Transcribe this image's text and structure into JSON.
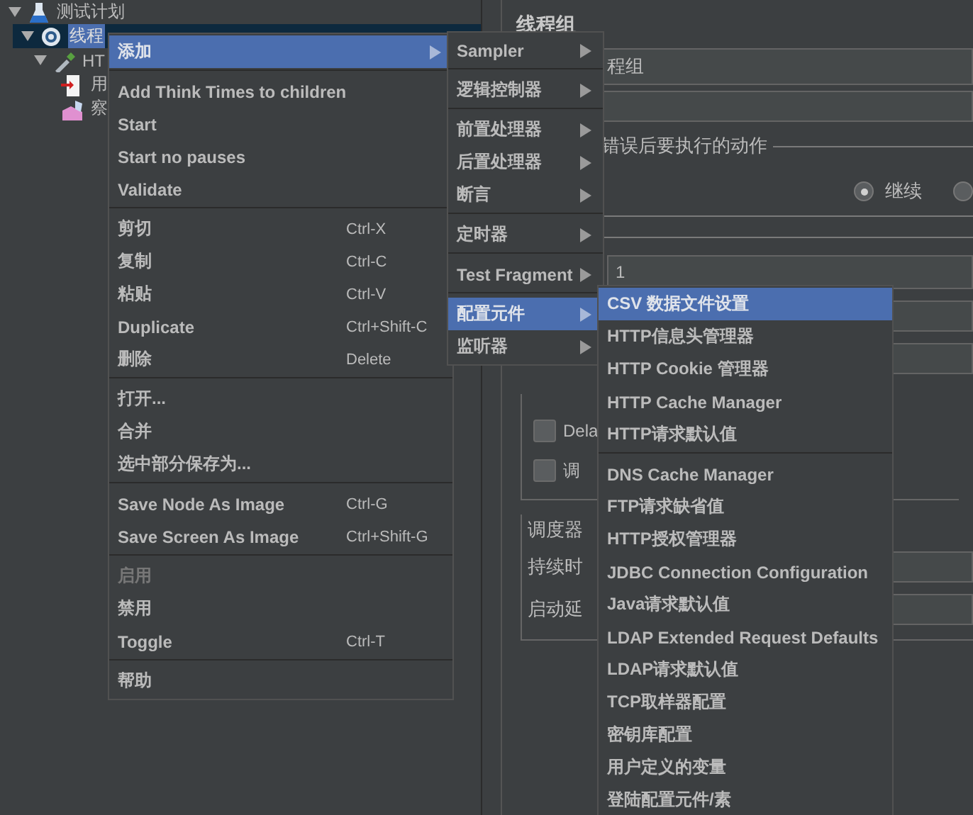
{
  "tree": [
    {
      "kind": "test-plan",
      "label": "测试计划",
      "expanded": true,
      "selected": false,
      "children": [
        {
          "kind": "thread-group",
          "label": "线程",
          "expanded": true,
          "selected": true,
          "children": [
            {
              "kind": "sampler",
              "label": "HT",
              "expanded": true,
              "selected": false,
              "children": [
                {
                  "kind": "config",
                  "label": "用",
                  "selected": false
                },
                {
                  "kind": "listener",
                  "label": "察",
                  "selected": false
                }
              ]
            }
          ]
        }
      ]
    }
  ],
  "form": {
    "title": "线程组",
    "name_value": "程组",
    "on_error_title": "错误后要执行的动作",
    "radios": [
      {
        "label": "继续",
        "selected": true
      },
      {
        "selected": false
      }
    ],
    "thread_count_value": "1",
    "checkboxes": [
      {
        "label": "Dela",
        "checked": false
      },
      {
        "label": "调",
        "checked": false
      }
    ],
    "scheduler_title": "调度器",
    "scheduler_rows": [
      "持续时",
      "启动延"
    ]
  },
  "menus": [
    {
      "items": [
        {
          "kind": "item",
          "label": "添加",
          "submenu": true,
          "selected": true,
          "disabled": false
        },
        {
          "kind": "separator"
        },
        {
          "kind": "item",
          "label": "Add Think Times to children",
          "submenu": false,
          "selected": false,
          "disabled": false
        },
        {
          "kind": "item",
          "label": "Start",
          "submenu": false,
          "selected": false,
          "disabled": false
        },
        {
          "kind": "item",
          "label": "Start no pauses",
          "submenu": false,
          "selected": false,
          "disabled": false
        },
        {
          "kind": "item",
          "label": "Validate",
          "submenu": false,
          "selected": false,
          "disabled": false
        },
        {
          "kind": "separator"
        },
        {
          "kind": "item",
          "label": "剪切",
          "shortcut": "Ctrl-X",
          "submenu": false,
          "selected": false,
          "disabled": false
        },
        {
          "kind": "item",
          "label": "复制",
          "shortcut": "Ctrl-C",
          "submenu": false,
          "selected": false,
          "disabled": false
        },
        {
          "kind": "item",
          "label": "粘贴",
          "shortcut": "Ctrl-V",
          "submenu": false,
          "selected": false,
          "disabled": false
        },
        {
          "kind": "item",
          "label": "Duplicate",
          "shortcut": "Ctrl+Shift-C",
          "submenu": false,
          "selected": false,
          "disabled": false
        },
        {
          "kind": "item",
          "label": "删除",
          "shortcut": "Delete",
          "submenu": false,
          "selected": false,
          "disabled": false
        },
        {
          "kind": "separator"
        },
        {
          "kind": "item",
          "label": "打开...",
          "submenu": false,
          "selected": false,
          "disabled": false
        },
        {
          "kind": "item",
          "label": "合并",
          "submenu": false,
          "selected": false,
          "disabled": false
        },
        {
          "kind": "item",
          "label": "选中部分保存为...",
          "submenu": false,
          "selected": false,
          "disabled": false
        },
        {
          "kind": "separator"
        },
        {
          "kind": "item",
          "label": "Save Node As Image",
          "shortcut": "Ctrl-G",
          "submenu": false,
          "selected": false,
          "disabled": false
        },
        {
          "kind": "item",
          "label": "Save Screen As Image",
          "shortcut": "Ctrl+Shift-G",
          "submenu": false,
          "selected": false,
          "disabled": false
        },
        {
          "kind": "separator"
        },
        {
          "kind": "item",
          "label": "启用",
          "submenu": false,
          "selected": false,
          "disabled": true
        },
        {
          "kind": "item",
          "label": "禁用",
          "submenu": false,
          "selected": false,
          "disabled": false
        },
        {
          "kind": "item",
          "label": "Toggle",
          "shortcut": "Ctrl-T",
          "submenu": false,
          "selected": false,
          "disabled": false
        },
        {
          "kind": "separator"
        },
        {
          "kind": "item",
          "label": "帮助",
          "submenu": false,
          "selected": false,
          "disabled": false
        }
      ]
    },
    {
      "items": [
        {
          "kind": "item",
          "label": "Sampler",
          "submenu": true,
          "selected": false,
          "disabled": false
        },
        {
          "kind": "separator"
        },
        {
          "kind": "item",
          "label": "逻辑控制器",
          "submenu": true,
          "selected": false,
          "disabled": false
        },
        {
          "kind": "separator"
        },
        {
          "kind": "item",
          "label": "前置处理器",
          "submenu": true,
          "selected": false,
          "disabled": false
        },
        {
          "kind": "item",
          "label": "后置处理器",
          "submenu": true,
          "selected": false,
          "disabled": false
        },
        {
          "kind": "item",
          "label": "断言",
          "submenu": true,
          "selected": false,
          "disabled": false
        },
        {
          "kind": "separator"
        },
        {
          "kind": "item",
          "label": "定时器",
          "submenu": true,
          "selected": false,
          "disabled": false
        },
        {
          "kind": "separator"
        },
        {
          "kind": "item",
          "label": "Test Fragment",
          "submenu": true,
          "selected": false,
          "disabled": false
        },
        {
          "kind": "separator"
        },
        {
          "kind": "item",
          "label": "配置元件",
          "submenu": true,
          "selected": true,
          "disabled": false
        },
        {
          "kind": "item",
          "label": "监听器",
          "submenu": true,
          "selected": false,
          "disabled": false
        }
      ]
    },
    {
      "items": [
        {
          "kind": "item",
          "label": "CSV 数据文件设置",
          "submenu": false,
          "selected": true,
          "disabled": false
        },
        {
          "kind": "item",
          "label": "HTTP信息头管理器",
          "submenu": false,
          "selected": false,
          "disabled": false
        },
        {
          "kind": "item",
          "label": "HTTP Cookie 管理器",
          "submenu": false,
          "selected": false,
          "disabled": false
        },
        {
          "kind": "item",
          "label": "HTTP Cache Manager",
          "submenu": false,
          "selected": false,
          "disabled": false
        },
        {
          "kind": "item",
          "label": "HTTP请求默认值",
          "submenu": false,
          "selected": false,
          "disabled": false
        },
        {
          "kind": "separator"
        },
        {
          "kind": "item",
          "label": "DNS Cache Manager",
          "submenu": false,
          "selected": false,
          "disabled": false
        },
        {
          "kind": "item",
          "label": "FTP请求缺省值",
          "submenu": false,
          "selected": false,
          "disabled": false
        },
        {
          "kind": "item",
          "label": "HTTP授权管理器",
          "submenu": false,
          "selected": false,
          "disabled": false
        },
        {
          "kind": "item",
          "label": "JDBC Connection Configuration",
          "submenu": false,
          "selected": false,
          "disabled": false
        },
        {
          "kind": "item",
          "label": "Java请求默认值",
          "submenu": false,
          "selected": false,
          "disabled": false
        },
        {
          "kind": "item",
          "label": "LDAP Extended Request Defaults",
          "submenu": false,
          "selected": false,
          "disabled": false
        },
        {
          "kind": "item",
          "label": "LDAP请求默认值",
          "submenu": false,
          "selected": false,
          "disabled": false
        },
        {
          "kind": "item",
          "label": "TCP取样器配置",
          "submenu": false,
          "selected": false,
          "disabled": false
        },
        {
          "kind": "item",
          "label": "密钥库配置",
          "submenu": false,
          "selected": false,
          "disabled": false
        },
        {
          "kind": "item",
          "label": "用户定义的变量",
          "submenu": false,
          "selected": false,
          "disabled": false
        },
        {
          "kind": "item",
          "label": "登陆配置元件/素",
          "submenu": false,
          "selected": false,
          "disabled": false
        }
      ]
    }
  ]
}
